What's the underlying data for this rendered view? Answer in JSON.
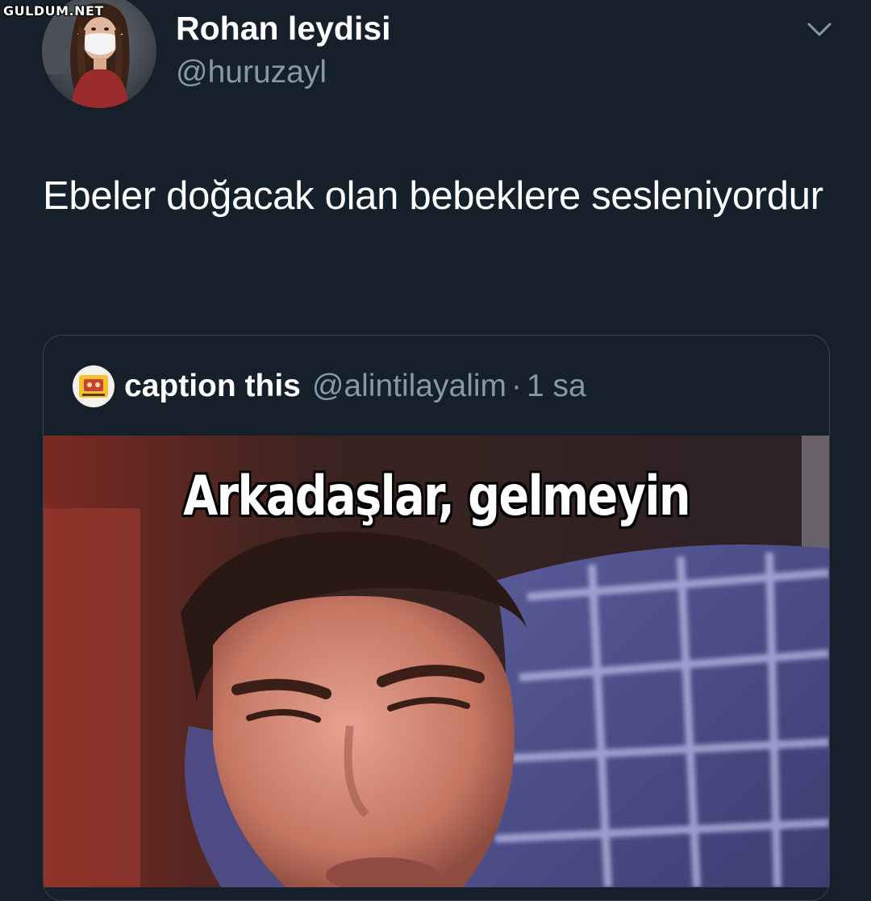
{
  "watermark": "GULDUM.NET",
  "tweet": {
    "author_name": "Rohan leydisi",
    "author_handle": "@huruzayl",
    "text": "Ebeler doğacak olan bebeklere sesleniyordur",
    "menu_icon": "chevron-down-icon"
  },
  "quoted_tweet": {
    "author_name": "caption this",
    "author_handle": "@alintilayalim",
    "separator": "·",
    "time": "1 sa",
    "media_caption": "Arkadaşlar, gelmeyin"
  },
  "colors": {
    "background": "#15202b",
    "secondary_text": "#8899a6",
    "border": "#38444d"
  }
}
